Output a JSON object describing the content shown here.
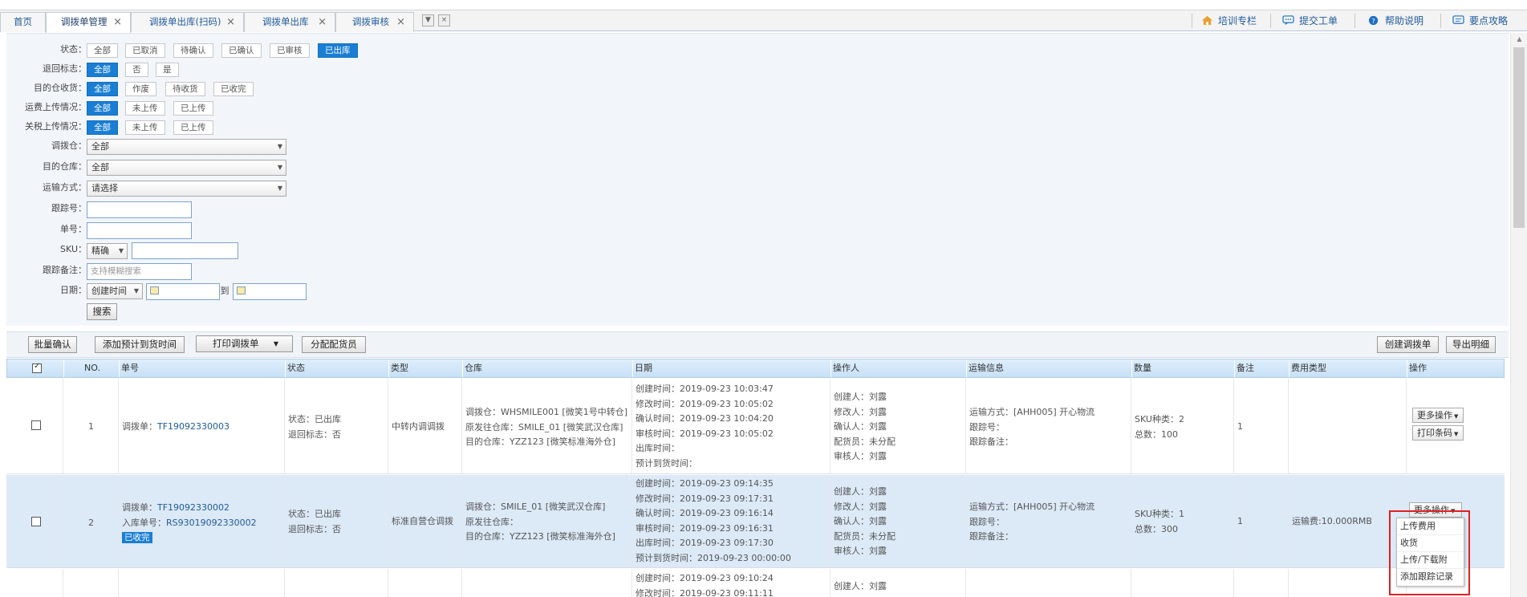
{
  "tabs": [
    {
      "label": "首页",
      "close": false
    },
    {
      "label": "调拨单管理",
      "close": true,
      "active": true
    },
    {
      "label": "调拨单出库(扫码)",
      "close": true
    },
    {
      "label": "调拨单出库",
      "close": true
    },
    {
      "label": "调拨审核",
      "close": true
    }
  ],
  "header_links": [
    {
      "label": "培训专栏",
      "icon": "home-icon"
    },
    {
      "label": "提交工单",
      "icon": "chat-icon"
    },
    {
      "label": "帮助说明",
      "icon": "help-icon"
    },
    {
      "label": "要点攻略",
      "icon": "message-icon"
    }
  ],
  "filters": {
    "status": {
      "label": "状态：",
      "options": [
        "全部",
        "已取消",
        "待确认",
        "已确认",
        "已审核",
        "已出库"
      ],
      "selected": "已出库"
    },
    "return": {
      "label": "退回标志：",
      "options": [
        "全部",
        "否",
        "是"
      ],
      "selected": "全部"
    },
    "receive": {
      "label": "目的仓收货：",
      "options": [
        "全部",
        "作废",
        "待收货",
        "已收完"
      ],
      "selected": "全部"
    },
    "freight": {
      "label": "运费上传情况：",
      "options": [
        "全部",
        "未上传",
        "已上传"
      ],
      "selected": "全部"
    },
    "tax": {
      "label": "关税上传情况：",
      "options": [
        "全部",
        "未上传",
        "已上传"
      ],
      "selected": "全部"
    },
    "from_wh": {
      "label": "调拨仓：",
      "value": "全部"
    },
    "to_wh": {
      "label": "目的仓库：",
      "value": "全部"
    },
    "transport": {
      "label": "运输方式：",
      "value": "请选择"
    },
    "tracking": {
      "label": "跟踪号：",
      "value": ""
    },
    "order_no": {
      "label": "单号：",
      "value": ""
    },
    "sku": {
      "label": "SKU：",
      "mode": "精确",
      "value": ""
    },
    "tracking_note": {
      "label": "跟踪备注：",
      "placeholder": "支持模糊搜索"
    },
    "date": {
      "label": "日期：",
      "type": "创建时间",
      "to": "到"
    },
    "search_label": "搜索"
  },
  "toolbar": {
    "batch_confirm": "批量确认",
    "add_eta": "添加预计到货时间",
    "print": "打印调拨单",
    "assign": "分配配货员",
    "create": "创建调拨单",
    "export": "导出明细"
  },
  "columns": [
    "NO.",
    "单号",
    "状态",
    "类型",
    "仓库",
    "日期",
    "操作人",
    "运输信息",
    "数量",
    "备注",
    "费用类型",
    "操作"
  ],
  "rows": [
    {
      "no": "1",
      "order": [
        "调拨单：",
        "TF19092330003"
      ],
      "status": [
        "状态：已出库",
        "退回标志：否"
      ],
      "type": "中转内调调拨",
      "warehouse": [
        "调拨仓：WHSMILE001 [微笑1号中转仓]",
        "原发往仓库：SMILE_01 [微笑武汉仓库]",
        "目的仓库：YZZ123 [微笑标准海外仓]"
      ],
      "dates": [
        "创建时间：2019-09-23 10:03:47",
        "修改时间：2019-09-23 10:05:02",
        "确认时间：2019-09-23 10:04:20",
        "审核时间：2019-09-23 10:05:02",
        "出库时间：",
        "预计到货时间："
      ],
      "operators": [
        "创建人：刘露",
        "修改人：刘露",
        "确认人：刘露",
        "配货员：未分配",
        "审核人：刘露"
      ],
      "transport": [
        "运输方式：[AHH005] 开心物流",
        "跟踪号：",
        "跟踪备注："
      ],
      "qty": [
        "SKU种类：2",
        "总数：100"
      ],
      "remark": "1",
      "fee": "",
      "actions": [
        "更多操作",
        "打印条码"
      ]
    },
    {
      "no": "2",
      "order": [
        "调拨单：",
        "TF19092330002",
        "入库单号：",
        "RS93019092330002",
        "已收完"
      ],
      "status": [
        "状态：已出库",
        "退回标志：否"
      ],
      "type": "标准自营仓调拨",
      "warehouse": [
        "调拨仓：SMILE_01 [微笑武汉仓库]",
        "原发往仓库：",
        "目的仓库：YZZ123 [微笑标准海外仓]"
      ],
      "dates": [
        "创建时间：2019-09-23 09:14:35",
        "修改时间：2019-09-23 09:17:31",
        "确认时间：2019-09-23 09:16:14",
        "审核时间：2019-09-23 09:16:31",
        "出库时间：2019-09-23 09:17:30",
        "预计到货时间：2019-09-23 00:00:00"
      ],
      "operators": [
        "创建人：刘露",
        "修改人：刘露",
        "确认人：刘露",
        "配货员：未分配",
        "审核人：刘露"
      ],
      "transport": [
        "运输方式：[AHH005] 开心物流",
        "跟踪号：",
        "跟踪备注："
      ],
      "qty": [
        "SKU种类：1",
        "总数：300"
      ],
      "remark": "1",
      "fee": "运输费:10.000RMB",
      "actions": [
        "更多操作"
      ]
    },
    {
      "dates": [
        "创建时间：2019-09-23 09:10:24",
        "修改时间：2019-09-23 09:11:11"
      ],
      "operators": [
        "创建人：刘露"
      ]
    }
  ],
  "more_menu": [
    "上传费用",
    "收货",
    "上传/下载附",
    "添加跟踪记录"
  ]
}
